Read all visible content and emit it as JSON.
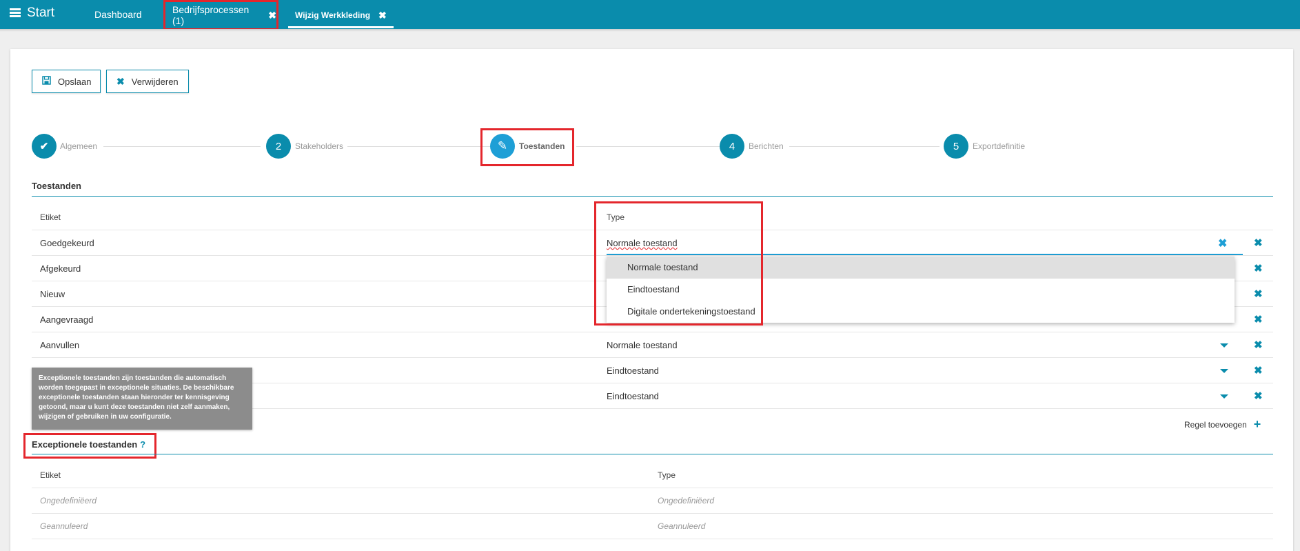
{
  "topbar": {
    "start_label": "Start",
    "tabs": [
      {
        "label": "Dashboard"
      },
      {
        "label": "Bedrijfsprocessen (1)",
        "close": "✖"
      },
      {
        "label": "Wijzig Werkkleding",
        "close": "✖"
      }
    ]
  },
  "toolbar": {
    "save_label": "Opslaan",
    "delete_label": "Verwijderen"
  },
  "stepper": {
    "steps": [
      {
        "number": "✔",
        "label": "Algemeen",
        "state": "done"
      },
      {
        "number": "2",
        "label": "Stakeholders",
        "state": "todo"
      },
      {
        "number": "✎",
        "label": "Toestanden",
        "state": "active"
      },
      {
        "number": "4",
        "label": "Berichten",
        "state": "todo"
      },
      {
        "number": "5",
        "label": "Exportdefinitie",
        "state": "todo"
      }
    ]
  },
  "toestanden": {
    "title": "Toestanden",
    "col_label": "Etiket",
    "col_type": "Type",
    "rows": [
      {
        "etiket": "Goedgekeurd",
        "type": "Normale toestand"
      },
      {
        "etiket": "Afgekeurd",
        "type": ""
      },
      {
        "etiket": "Nieuw",
        "type": ""
      },
      {
        "etiket": "Aangevraagd",
        "type": ""
      },
      {
        "etiket": "Aanvullen",
        "type": "Normale toestand"
      },
      {
        "etiket": "",
        "type": "Eindtoestand"
      },
      {
        "etiket": "",
        "type": "Eindtoestand"
      }
    ],
    "add_row_label": "Regel toevoegen",
    "dropdown_options": [
      "Normale toestand",
      "Eindtoestand",
      "Digitale ondertekeningstoestand"
    ],
    "dropdown_selected": "Normale toestand"
  },
  "tooltip": {
    "text": "Exceptionele toestanden zijn toestanden die automatisch worden toegepast in exceptionele situaties. De beschikbare exceptionele toestanden staan hieronder ter kennisgeving getoond, maar u kunt deze toestanden niet zelf aanmaken, wijzigen of gebruiken in uw configuratie."
  },
  "exceptionele": {
    "title": "Exceptionele toestanden",
    "help": "?",
    "col_label": "Etiket",
    "col_type": "Type",
    "rows": [
      {
        "etiket": "Ongedefiniëerd",
        "type": "Ongedefiniëerd"
      },
      {
        "etiket": "Geannuleerd",
        "type": "Geannuleerd"
      }
    ]
  },
  "colors": {
    "primary": "#0a8cac",
    "active_step": "#1e9fd6",
    "highlight": "#e4262c"
  }
}
